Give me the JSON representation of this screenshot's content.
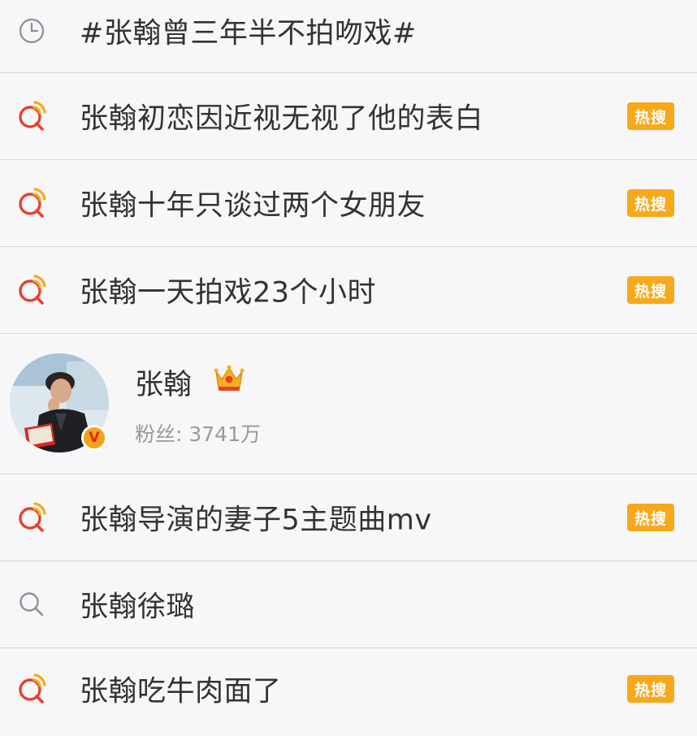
{
  "history": {
    "icon": "clock-icon",
    "text": "#张翰曾三年半不拍吻戏#"
  },
  "suggestions_top": [
    {
      "icon": "hot-search-icon",
      "text": "张翰初恋因近视无视了他的表白",
      "badge": "热搜"
    },
    {
      "icon": "hot-search-icon",
      "text": "张翰十年只谈过两个女朋友",
      "badge": "热搜"
    },
    {
      "icon": "hot-search-icon",
      "text": "张翰一天拍戏23个小时",
      "badge": "热搜"
    }
  ],
  "profile": {
    "name": "张翰",
    "fans": "粉丝: 3741万",
    "verified_symbol": "V",
    "crown_icon": "crown-icon",
    "verified_color": "#f3a31c"
  },
  "suggestions_bottom": [
    {
      "icon": "hot-search-icon",
      "text": "张翰导演的妻子5主题曲mv",
      "badge": "热搜"
    },
    {
      "icon": "search-icon",
      "text": "张翰徐璐",
      "badge": ""
    },
    {
      "icon": "hot-search-icon",
      "text": "张翰吃牛肉面了",
      "badge": "热搜"
    }
  ],
  "colors": {
    "badge": "#f7a91a",
    "hot_icon_red": "#e8412c",
    "hot_icon_orange": "#f7a91a",
    "divider": "#d9d9dd",
    "text": "#333333",
    "subtext": "#9a9a9a"
  }
}
